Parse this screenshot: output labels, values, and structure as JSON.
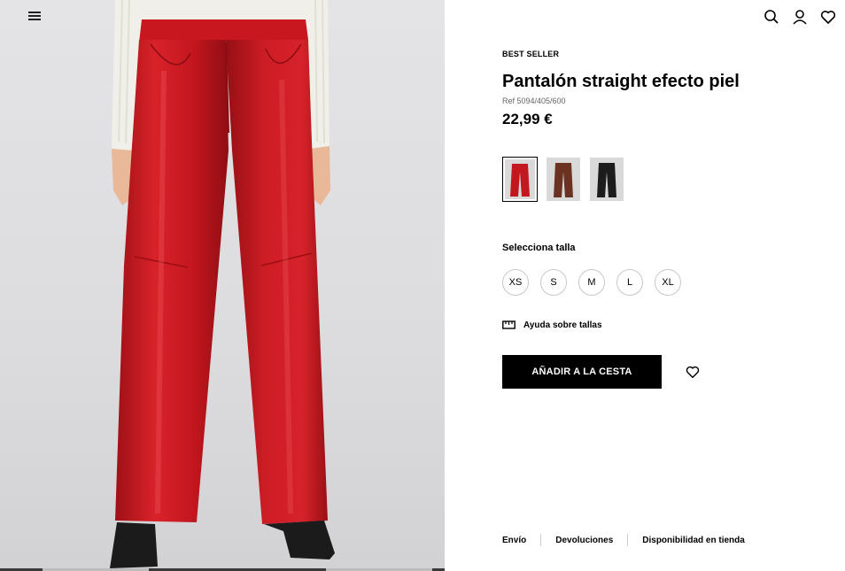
{
  "header": {
    "menu_icon": "hamburger-menu-icon",
    "icons": [
      "search-icon",
      "user-icon",
      "heart-icon"
    ]
  },
  "gallery": {
    "image_count": 3,
    "active_index": 1
  },
  "product": {
    "badge": "BEST SELLER",
    "title": "Pantalón straight efecto piel",
    "ref": "Ref 5094/405/600",
    "price": "22,99 €",
    "colors": [
      {
        "name": "red",
        "hex": "#c3181f",
        "selected": true
      },
      {
        "name": "brown",
        "hex": "#6b3222",
        "selected": false
      },
      {
        "name": "black",
        "hex": "#1c1c1c",
        "selected": false
      }
    ]
  },
  "sizes": {
    "label": "Selecciona talla",
    "options": [
      "XS",
      "S",
      "M",
      "L",
      "XL"
    ]
  },
  "size_help": {
    "label": "Ayuda sobre tallas",
    "icon": "ruler-icon"
  },
  "actions": {
    "add_to_cart": "AÑADIR A LA CESTA",
    "wishlist_icon": "heart-icon"
  },
  "footer": {
    "links": [
      "Envío",
      "Devoluciones",
      "Disponibilidad en tienda"
    ]
  },
  "colors": {
    "accent": "#000000",
    "pants_red": "#c3181f",
    "background_grey": "#dcdcde"
  }
}
